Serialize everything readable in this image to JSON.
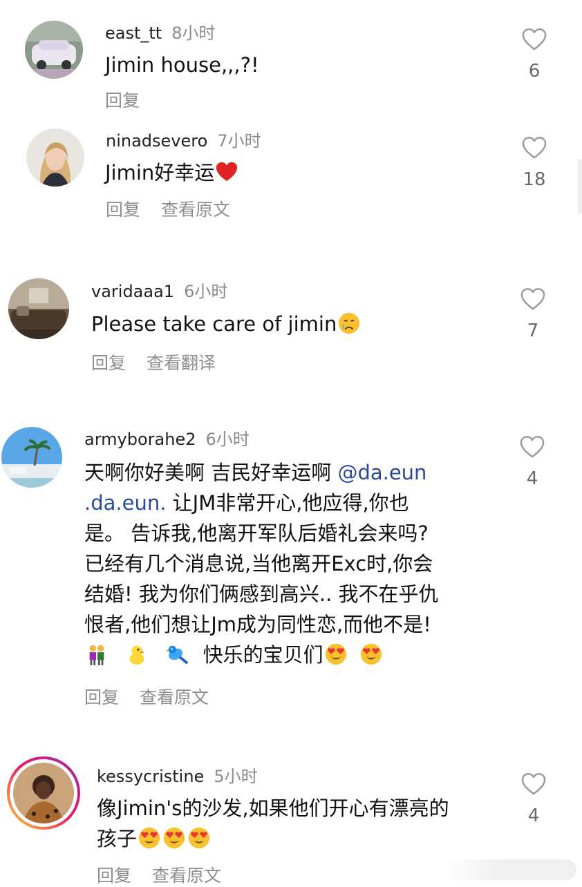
{
  "comments": [
    {
      "username": "east_tt",
      "time": "8小时",
      "text": "Jimin house,,,?!",
      "actions": [
        "回复"
      ],
      "likes": "6",
      "avatar": "white-car-avatar"
    },
    {
      "username": "ninadsevero",
      "time": "7小时",
      "text": "Jimin好幸运",
      "emoji": "red-heart-emoji",
      "actions": [
        "回复",
        "查看原文"
      ],
      "likes": "18",
      "avatar": "blonde-woman-avatar"
    },
    {
      "username": "varidaaa1",
      "time": "6小时",
      "text": "Please take care of jimin",
      "emoji": "crying-face-emoji",
      "actions": [
        "回复",
        "查看翻译"
      ],
      "likes": "7",
      "avatar": "living-room-avatar"
    },
    {
      "username": "armyborahe2",
      "time": "6小时",
      "lines": [
        {
          "pre": "天啊你好美啊 吉民好幸运啊 ",
          "mention": "@da.eun"
        },
        {
          "mention": ".da.eun.",
          "post": " 让JM非常开心,他应得,你也"
        },
        {
          "pre": "是。 告诉我,他离开军队后婚礼会来吗?"
        },
        {
          "pre": "已经有几个消息说,当他离开Exc时,你会"
        },
        {
          "pre": "结婚! 我为你们俩感到高兴.. 我不在乎仇"
        },
        {
          "pre": "恨者,他们想让Jm成为同性恋,而他不是!"
        }
      ],
      "emoji_line_text": "快乐的宝贝们",
      "actions": [
        "回复",
        "查看原文"
      ],
      "likes": "4",
      "avatar": "beach-palm-avatar"
    },
    {
      "username": "kessycristine",
      "time": "5小时",
      "line1": "像Jimin's的沙发,如果他们开心有漂亮的",
      "line2": "孩子",
      "actions": [
        "回复",
        "查看原文"
      ],
      "likes": "4",
      "avatar": "woman-story-ring-avatar"
    }
  ],
  "colors": {
    "text": "#111111",
    "muted": "#8e8e8e",
    "mention": "#2a4a9a",
    "heart": "#e02424"
  }
}
